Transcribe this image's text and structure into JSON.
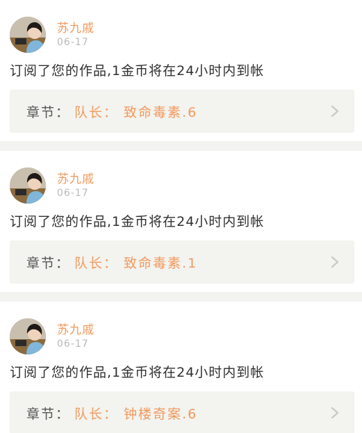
{
  "notifications": [
    {
      "author": "苏九戚",
      "date": "06-17",
      "message": "订阅了您的作品,1金币将在24小时内到帐",
      "chapter_prefix": "章节：",
      "chapter_title": "队长： 致命毒素.6"
    },
    {
      "author": "苏九戚",
      "date": "06-17",
      "message": "订阅了您的作品,1金币将在24小时内到帐",
      "chapter_prefix": "章节：",
      "chapter_title": "队长： 致命毒素.1"
    },
    {
      "author": "苏九戚",
      "date": "06-17",
      "message": "订阅了您的作品,1金币将在24小时内到帐",
      "chapter_prefix": "章节：",
      "chapter_title": "队长： 钟楼奇案.6"
    }
  ],
  "icons": {
    "chevron": "chevron-right-icon",
    "avatar": "user-avatar"
  },
  "colors": {
    "accent": "#f19a5e",
    "date": "#b9b9b9",
    "card_bg": "#f3f3ef",
    "page_bg": "#f3f3f2"
  }
}
